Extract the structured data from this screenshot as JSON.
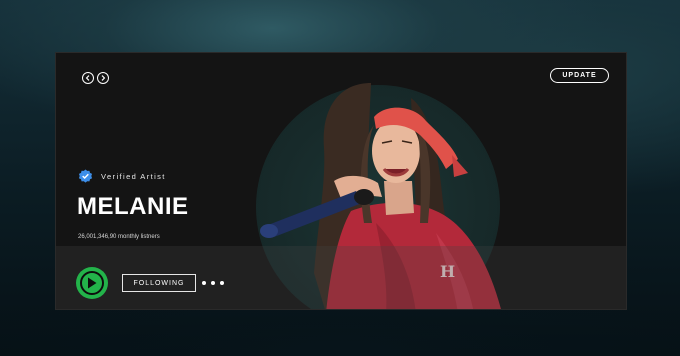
{
  "nav": {
    "back_icon": "chevron-left-icon",
    "forward_icon": "chevron-right-icon"
  },
  "header": {
    "update_label": "UPDATE"
  },
  "artist": {
    "verified_label": "Verified Artist",
    "name": "MELANIE",
    "monthly_listeners": "26,001,346,90 monthly listners"
  },
  "actions": {
    "play_icon": "play-icon",
    "following_label": "FOLLOWING",
    "more_icon": "more-options-icon"
  },
  "colors": {
    "accent_green": "#23b34a",
    "verified_blue": "#3d8ee8",
    "bandana_red": "#e0524a",
    "shirt_red": "#b3293a"
  }
}
